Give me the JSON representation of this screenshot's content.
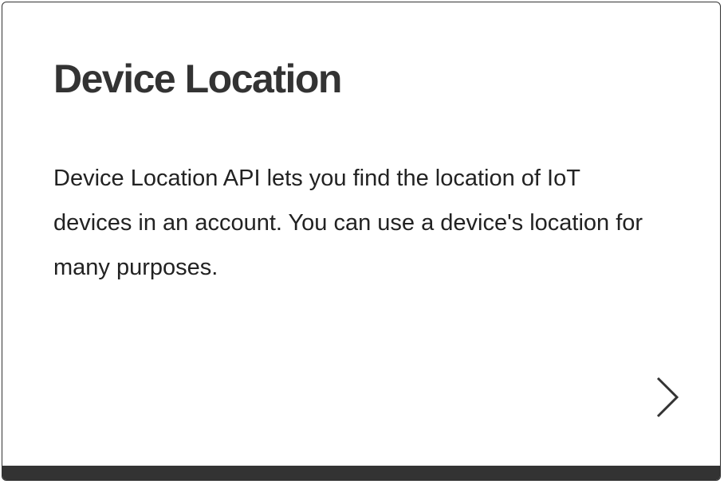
{
  "card": {
    "title": "Device Location",
    "description": "Device Location API lets you find the location of IoT devices in an account. You can use a device's location for many purposes.",
    "arrow_icon": "chevron-right-icon",
    "colors": {
      "text": "#222222",
      "border": "#333333",
      "bottom_bar": "#333333",
      "background": "#ffffff"
    }
  }
}
